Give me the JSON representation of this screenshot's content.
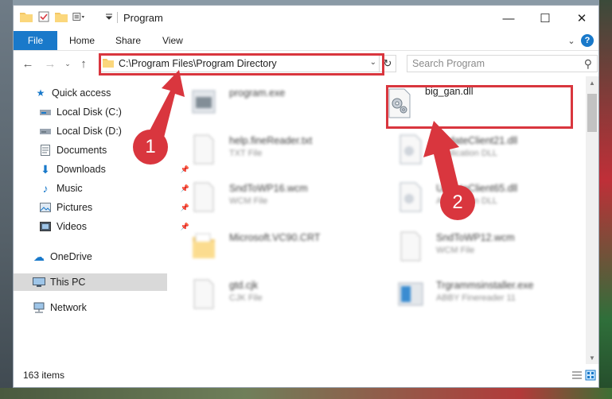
{
  "window": {
    "title": "Program",
    "controls": {
      "minimize": "—",
      "maximize": "☐",
      "close": "✕"
    }
  },
  "ribbon": {
    "tabs": [
      "File",
      "Home",
      "Share",
      "View"
    ],
    "help": "?"
  },
  "address_bar": {
    "path": "C:\\Program Files\\Program Directory"
  },
  "search": {
    "placeholder": "Search Program"
  },
  "sidebar": {
    "items": [
      {
        "label": "Quick access",
        "icon": "star-icon"
      },
      {
        "label": "Local Disk (C:)",
        "icon": "drive-icon"
      },
      {
        "label": "Local Disk (D:)",
        "icon": "drive-icon"
      },
      {
        "label": "Documents",
        "icon": "documents-icon"
      },
      {
        "label": "Downloads",
        "icon": "download-icon",
        "pinned": true
      },
      {
        "label": "Music",
        "icon": "music-icon",
        "pinned": true
      },
      {
        "label": "Pictures",
        "icon": "pictures-icon",
        "pinned": true
      },
      {
        "label": "Videos",
        "icon": "videos-icon",
        "pinned": true
      },
      {
        "label": "OneDrive",
        "icon": "cloud-icon"
      },
      {
        "label": "This PC",
        "icon": "computer-icon",
        "selected": true
      },
      {
        "label": "Network",
        "icon": "network-icon"
      }
    ]
  },
  "files": [
    {
      "name": "program.exe",
      "type": "",
      "blurred": true
    },
    {
      "name": "big_gan.dll",
      "type": "",
      "blurred": false,
      "highlighted": true
    },
    {
      "name": "help.fineReader.txt",
      "type": "TXT File",
      "blurred": true
    },
    {
      "name": "UpdateClient21.dll",
      "type": "Application DLL",
      "blurred": true
    },
    {
      "name": "SndToWP16.wcm",
      "type": "WCM File",
      "blurred": true
    },
    {
      "name": "UpdateClient65.dll",
      "type": "Application DLL",
      "blurred": true
    },
    {
      "name": "Microsoft.VC90.CRT",
      "type": "",
      "blurred": true
    },
    {
      "name": "SndToWP12.wcm",
      "type": "WCM File",
      "blurred": true
    },
    {
      "name": "gtd.cjk",
      "type": "CJK File",
      "blurred": true
    },
    {
      "name": "Trgrammsinstaller.exe",
      "type": "ABBY Finereader 11",
      "blurred": true
    }
  ],
  "status": {
    "item_count": "163 items"
  },
  "annotations": {
    "step1": "1",
    "step2": "2"
  },
  "colors": {
    "accent": "#1979ca",
    "highlight": "#d9363e"
  }
}
